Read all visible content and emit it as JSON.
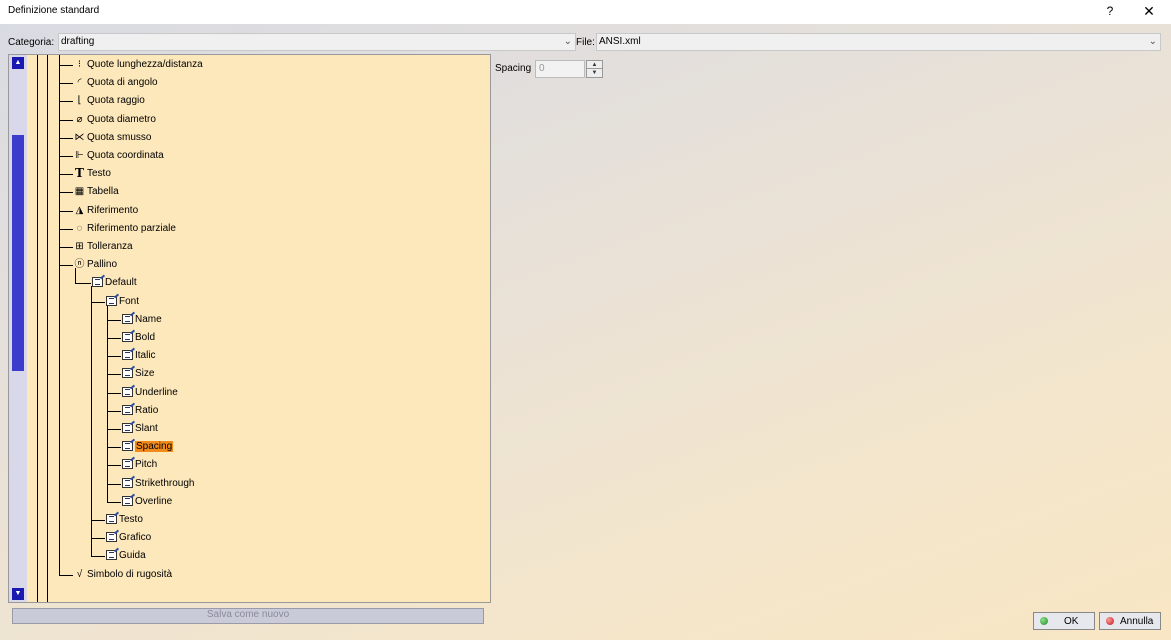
{
  "window": {
    "title": "Definizione standard",
    "help_glyph": "?",
    "close_glyph": "✕"
  },
  "category": {
    "label": "Categoria:",
    "value": "drafting"
  },
  "file": {
    "label": "File:",
    "value": "ANSI.xml"
  },
  "tree": {
    "items": [
      {
        "label": "Quote lunghezza/distanza",
        "icon": "length-dimension-icon",
        "glyph": "⁝"
      },
      {
        "label": "Quota di angolo",
        "icon": "angle-dimension-icon",
        "glyph": "◜"
      },
      {
        "label": "Quota raggio",
        "icon": "radius-dimension-icon",
        "glyph": "⌊"
      },
      {
        "label": "Quota diametro",
        "icon": "diameter-dimension-icon",
        "glyph": "⌀"
      },
      {
        "label": "Quota smusso",
        "icon": "chamfer-dimension-icon",
        "glyph": "⋉"
      },
      {
        "label": "Quota coordinata",
        "icon": "coordinate-dimension-icon",
        "glyph": "⊩"
      },
      {
        "label": "Testo",
        "icon": "text-icon",
        "glyph": "T"
      },
      {
        "label": "Tabella",
        "icon": "table-icon",
        "glyph": "▦"
      },
      {
        "label": "Riferimento",
        "icon": "datum-icon",
        "glyph": "◮"
      },
      {
        "label": "Riferimento parziale",
        "icon": "datum-target-icon",
        "glyph": "◌"
      },
      {
        "label": "Tolleranza",
        "icon": "tolerance-icon",
        "glyph": "⊞"
      },
      {
        "label": "Pallino",
        "icon": "balloon-icon",
        "glyph": "ⓝ"
      },
      {
        "label": "Default"
      },
      {
        "label": "Font"
      },
      {
        "label": "Name"
      },
      {
        "label": "Bold"
      },
      {
        "label": "Italic"
      },
      {
        "label": "Size"
      },
      {
        "label": "Underline"
      },
      {
        "label": "Ratio"
      },
      {
        "label": "Slant"
      },
      {
        "label": "Spacing"
      },
      {
        "label": "Pitch"
      },
      {
        "label": "Strikethrough"
      },
      {
        "label": "Overline"
      },
      {
        "label": "Testo"
      },
      {
        "label": "Grafico"
      },
      {
        "label": "Guida"
      },
      {
        "label": "Simbolo di rugosità",
        "icon": "roughness-symbol-icon",
        "glyph": "√"
      }
    ],
    "selected": "Spacing"
  },
  "save_as_new": "Salva come nuovo",
  "property": {
    "label": "Spacing",
    "value": "0"
  },
  "buttons": {
    "ok": "OK",
    "cancel": "Annulla"
  }
}
